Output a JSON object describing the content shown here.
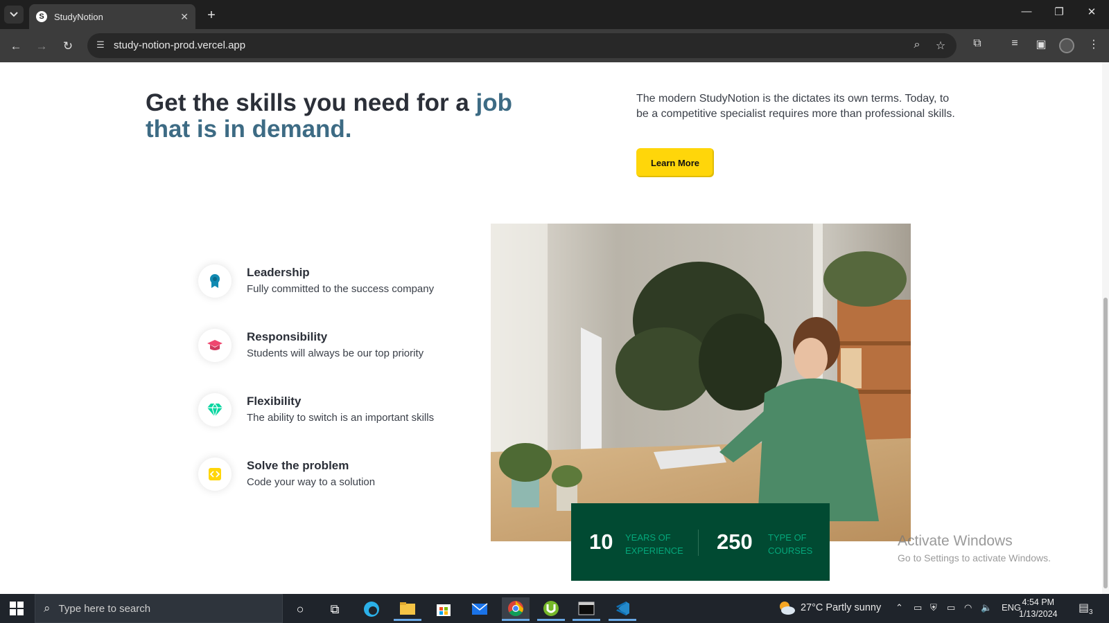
{
  "browser": {
    "tab_title": "StudyNotion",
    "tab_favicon": "S",
    "url": "study-notion-prod.vercel.app",
    "icons": [
      "tab-search-icon",
      "close-icon",
      "new-tab-icon",
      "minimize-icon",
      "restore-icon",
      "window-close-icon",
      "back-icon",
      "forward-icon",
      "reload-icon",
      "site-info-icon",
      "zoom-icon",
      "bookmark-star-icon",
      "extensions-icon",
      "media-icon",
      "side-panel-icon",
      "profile-avatar",
      "menu-dots-icon"
    ]
  },
  "hero": {
    "heading_plain": "Get the skills you need for a ",
    "heading_highlight": "job that is in demand.",
    "description": "The modern StudyNotion is the dictates its own terms. Today, to be a competitive specialist requires more than professional skills.",
    "button_label": "Learn More",
    "colors": {
      "accent": "#3d6b84",
      "button": "#ffd60a",
      "text": "#2b2f38"
    }
  },
  "features": [
    {
      "title": "Leadership",
      "subtitle": "Fully committed to the success company",
      "icon": "badge-medal-icon",
      "color": "#118ab2"
    },
    {
      "title": "Responsibility",
      "subtitle": "Students will always be our top priority",
      "icon": "graduation-cap-icon",
      "color": "#ef476f"
    },
    {
      "title": "Flexibility",
      "subtitle": "The ability to switch is an important skills",
      "icon": "diamond-icon",
      "color": "#06d6a0"
    },
    {
      "title": "Solve the problem",
      "subtitle": "Code your way to a solution",
      "icon": "code-icon",
      "color": "#ffd60a"
    }
  ],
  "stats": [
    {
      "value": "10",
      "label_line1": "YEARS OF",
      "label_line2": "EXPERIENCE"
    },
    {
      "value": "250",
      "label_line1": "TYPE OF",
      "label_line2": "COURSES"
    }
  ],
  "stats_colors": {
    "background": "#014a32",
    "label": "#05a77b"
  },
  "watermark": {
    "line1": "Activate Windows",
    "line2": "Go to Settings to activate Windows."
  },
  "taskbar": {
    "search_placeholder": "Type here to search",
    "weather": "27°C  Partly sunny",
    "language": "ENG",
    "time": "4:54 PM",
    "date": "1/13/2024",
    "notifications": "3",
    "apps": [
      "cortana-icon",
      "task-view-icon",
      "edge-icon",
      "file-explorer-icon",
      "store-icon",
      "mail-icon",
      "chrome-icon",
      "utorrent-icon",
      "terminal-icon",
      "vscode-icon"
    ]
  }
}
